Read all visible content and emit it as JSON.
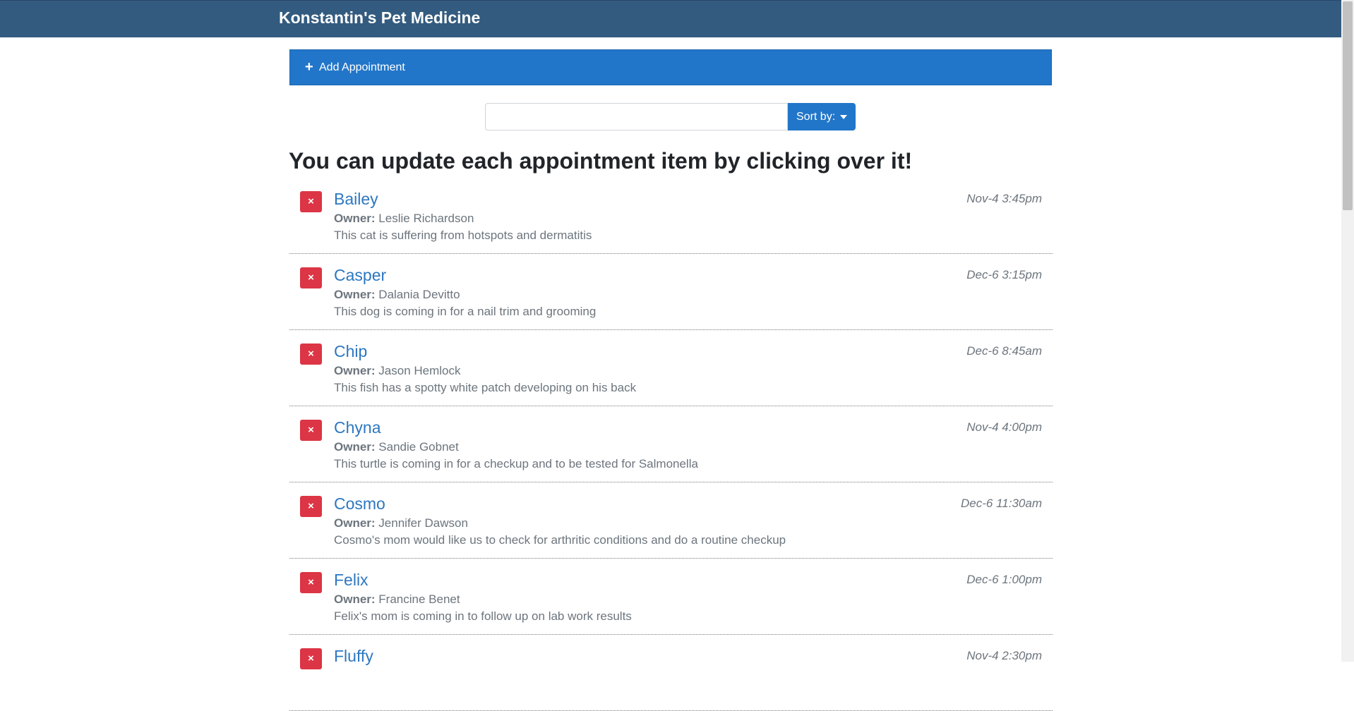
{
  "header": {
    "brand": "Konstantin's Pet Medicine"
  },
  "add_appointment": {
    "icon": "plus-icon",
    "label": "Add Appointment"
  },
  "search": {
    "value": "",
    "placeholder": ""
  },
  "sort": {
    "label": "Sort by:",
    "icon": "caret-down-icon"
  },
  "headline": "You can update each appointment item by clicking over it!",
  "owner_label": "Owner:",
  "delete_icon": "close-icon",
  "appointments": [
    {
      "petName": "Bailey",
      "ownerName": "Leslie Richardson",
      "aptNotes": "This cat is suffering from hotspots and dermatitis",
      "aptDate": "Nov-4 3:45pm"
    },
    {
      "petName": "Casper",
      "ownerName": "Dalania Devitto",
      "aptNotes": "This dog is coming in for a nail trim and grooming",
      "aptDate": "Dec-6 3:15pm"
    },
    {
      "petName": "Chip",
      "ownerName": "Jason Hemlock",
      "aptNotes": "This fish has a spotty white patch developing on his back",
      "aptDate": "Dec-6 8:45am"
    },
    {
      "petName": "Chyna",
      "ownerName": "Sandie Gobnet",
      "aptNotes": "This turtle is coming in for a checkup and to be tested for Salmonella",
      "aptDate": "Nov-4 4:00pm"
    },
    {
      "petName": "Cosmo",
      "ownerName": "Jennifer Dawson",
      "aptNotes": "Cosmo's mom would like us to check for arthritic conditions and do a routine checkup",
      "aptDate": "Dec-6 11:30am"
    },
    {
      "petName": "Felix",
      "ownerName": "Francine Benet",
      "aptNotes": "Felix's mom is coming in to follow up on lab work results",
      "aptDate": "Dec-6 1:00pm"
    },
    {
      "petName": "Fluffy",
      "ownerName": "",
      "aptNotes": "",
      "aptDate": "Nov-4 2:30pm"
    }
  ]
}
